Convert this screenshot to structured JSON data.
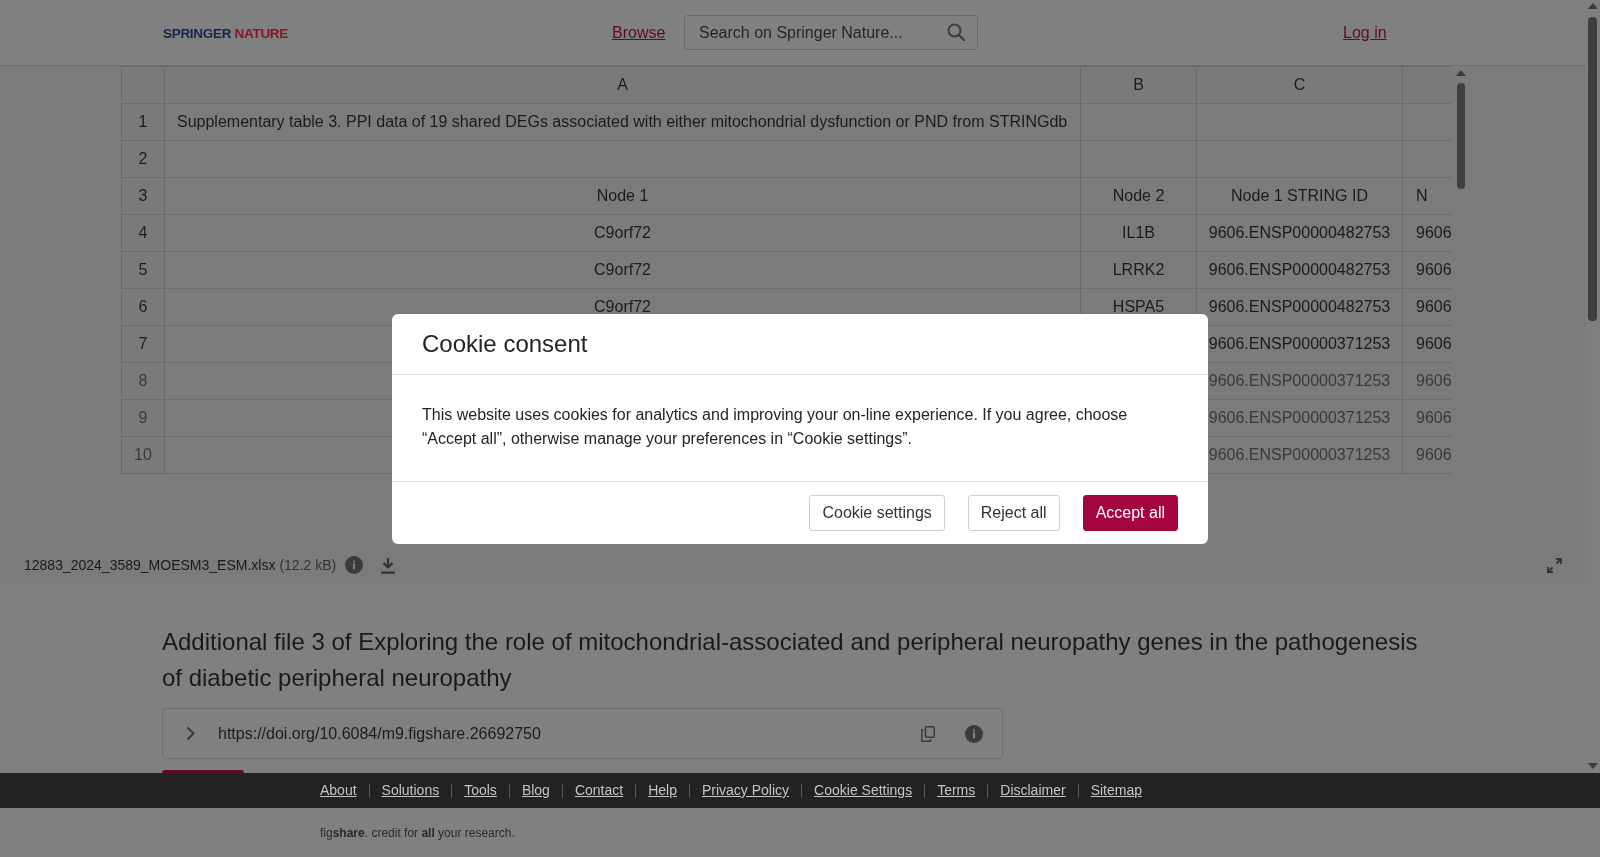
{
  "header": {
    "logo": [
      "SPRINGER",
      "NATURE"
    ],
    "browse_link": "Browse",
    "search": {
      "placeholder": "Search on Springer Nature..."
    },
    "login_link": "Log in"
  },
  "spreadsheet": {
    "columns": [
      "A",
      "B",
      "C"
    ],
    "rows": [
      {
        "number": "1",
        "kind": "title",
        "faded": false,
        "cells": {
          "A": "Supplementary table 3. PPI data of 19 shared DEGs associated with either mitochondrial dysfunction or PND from STRINGdb"
        }
      },
      {
        "number": "2",
        "kind": "data",
        "faded": false,
        "cells": {}
      },
      {
        "number": "3",
        "kind": "data",
        "faded": false,
        "cells": {
          "A": "Node 1",
          "B": "Node 2",
          "C": "Node 1 STRING ID",
          "D": "N"
        }
      },
      {
        "number": "4",
        "kind": "data",
        "faded": false,
        "cells": {
          "A": "C9orf72",
          "B": "IL1B",
          "C": "9606.ENSP00000482753",
          "D": "9606"
        }
      },
      {
        "number": "5",
        "kind": "data",
        "faded": false,
        "cells": {
          "A": "C9orf72",
          "B": "LRRK2",
          "C": "9606.ENSP00000482753",
          "D": "9606"
        }
      },
      {
        "number": "6",
        "kind": "data",
        "faded": false,
        "cells": {
          "A": "C9orf72",
          "B": "HSPA5",
          "C": "9606.ENSP00000482753",
          "D": "9606"
        }
      },
      {
        "number": "7",
        "kind": "data",
        "faded": false,
        "cells": {
          "C": "9606.ENSP00000371253",
          "D": "9606"
        }
      },
      {
        "number": "8",
        "kind": "data",
        "faded": true,
        "cells": {
          "C": "9606.ENSP00000371253",
          "D": "9606"
        }
      },
      {
        "number": "9",
        "kind": "data",
        "faded": true,
        "cells": {
          "C": "9606.ENSP00000371253",
          "D": "9606"
        }
      },
      {
        "number": "10",
        "kind": "data",
        "faded": true,
        "cells": {
          "C": "9606.ENSP00000371253",
          "D": "9606"
        }
      }
    ]
  },
  "file_bar": {
    "file_name": "12883_2024_3589_MOESM3_ESM.xlsx",
    "file_size": "(12.2 kB)"
  },
  "title": "Additional file 3 of Exploring the role of mitochondrial-associated and peripheral neuropathy genes in the pathogenesis of diabetic peripheral neuropathy",
  "doi": {
    "url": "https://doi.org/10.6084/m9.figshare.26692750"
  },
  "cookie_dialog": {
    "title": "Cookie consent",
    "message": "This website uses cookies for analytics and improving your on-line experience. If you agree, choose “Accept all”, otherwise manage your preferences in “Cookie settings”.",
    "buttons": [
      {
        "label": "Cookie settings",
        "kind": "secondary"
      },
      {
        "label": "Reject all",
        "kind": "secondary"
      },
      {
        "label": "Accept all",
        "kind": "primary"
      }
    ]
  },
  "footer": {
    "links": [
      "About",
      "Solutions",
      "Tools",
      "Blog",
      "Contact",
      "Help",
      "Privacy Policy",
      "Cookie Settings",
      "Terms",
      "Disclaimer",
      "Sitemap"
    ],
    "tagline": "fig**share**. credit for **all** your research."
  }
}
